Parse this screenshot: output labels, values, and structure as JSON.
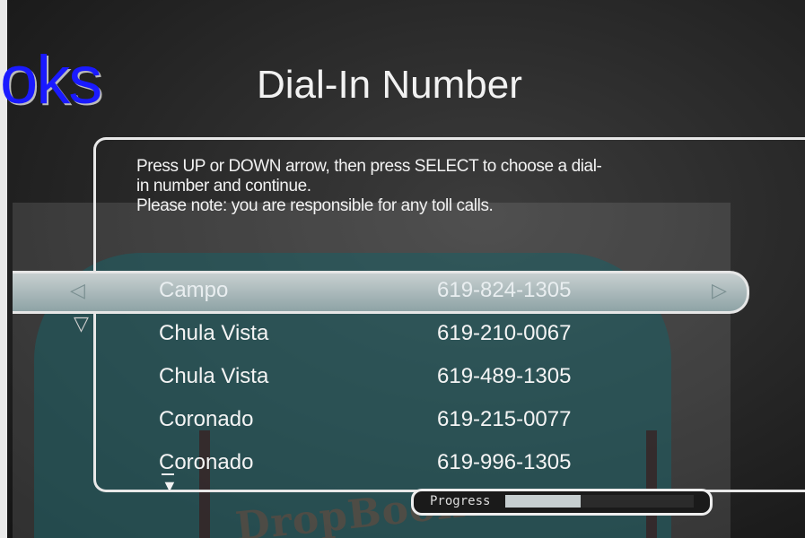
{
  "header": {
    "logo_fragment": "oks",
    "title": "Dial-In Number"
  },
  "instructions": {
    "line1": "Press UP or DOWN arrow, then press SELECT to choose a dial-",
    "line2": "in number and continue.",
    "line3": "Please note: you are responsible for any toll calls."
  },
  "list": {
    "selected_index": 0,
    "rows": [
      {
        "city": "Campo",
        "number": "619-824-1305"
      },
      {
        "city": "Chula Vista",
        "number": "619-210-0067"
      },
      {
        "city": "Chula Vista",
        "number": "619-489-1305"
      },
      {
        "city": "Coronado",
        "number": "619-215-0077"
      },
      {
        "city": "Coronado",
        "number": "619-996-1305"
      }
    ]
  },
  "progress": {
    "label": "Progress",
    "fraction": 0.4
  },
  "watermark": "DropBooks",
  "colors": {
    "background": "#262626",
    "text": "#f2f2f2",
    "selection": "#a9b8ba",
    "logo": "#1a1aff"
  },
  "icons": {
    "left_arrow": "left-arrow-icon",
    "right_arrow": "right-arrow-icon",
    "down_arrow": "down-arrow-icon",
    "more_below": "more-below-icon"
  }
}
